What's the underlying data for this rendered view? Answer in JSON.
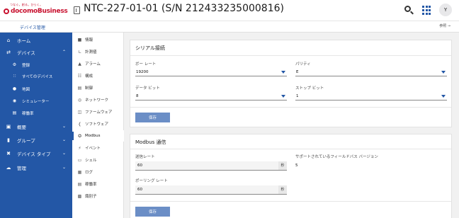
{
  "header": {
    "logo_tagline": "つなぐ。創る。ひらく。",
    "logo_brand_prefix": "docomo",
    "logo_brand_suffix": "Business",
    "page_title": "NTC-227-01-01 (S/N 212433235000816)",
    "avatar_initial": "Y"
  },
  "subheader": {
    "breadcrumb": "デバイス管理",
    "reference": "参照 →"
  },
  "sidebar": {
    "items": [
      {
        "label": "ホーム",
        "icon": "home-icon"
      },
      {
        "label": "デバイス",
        "icon": "swap-icon"
      },
      {
        "label": "登録",
        "icon": "register-icon"
      },
      {
        "label": "すべてのデバイス",
        "icon": "devices-icon"
      },
      {
        "label": "地図",
        "icon": "map-pin-icon"
      },
      {
        "label": "シミュレーター",
        "icon": "simulator-icon"
      },
      {
        "label": "稼働率",
        "icon": "chart-icon"
      },
      {
        "label": "概要",
        "icon": "overview-icon"
      },
      {
        "label": "グループ",
        "icon": "folder-icon"
      },
      {
        "label": "デバイス タイプ",
        "icon": "tools-icon"
      },
      {
        "label": "管理",
        "icon": "cloud-icon"
      }
    ]
  },
  "menu": {
    "items": [
      {
        "label": "情報"
      },
      {
        "label": "計測値"
      },
      {
        "label": "アラーム"
      },
      {
        "label": "構成"
      },
      {
        "label": "制御"
      },
      {
        "label": "ネットワーク"
      },
      {
        "label": "ファームウェア"
      },
      {
        "label": "ソフトウェア"
      },
      {
        "label": "Modbus"
      },
      {
        "label": "イベント"
      },
      {
        "label": "シェル"
      },
      {
        "label": "ログ"
      },
      {
        "label": "稼働率"
      },
      {
        "label": "識別子"
      }
    ]
  },
  "serial": {
    "title": "シリアル接続",
    "baud_label": "ボー レート",
    "baud_value": "19200",
    "parity_label": "パリティ",
    "parity_value": "E",
    "databits_label": "データ ビット",
    "databits_value": "8",
    "stopbits_label": "ストップ ビット",
    "stopbits_value": "1",
    "save_label": "保存"
  },
  "modbus": {
    "title": "Modbus 通信",
    "transmit_label": "送信レート",
    "transmit_value": "60",
    "transmit_unit": "秒",
    "fieldbus_label": "サポートされているフィールドバス バージョン",
    "fieldbus_value": "5",
    "polling_label": "ポーリング レート",
    "polling_value": "60",
    "polling_unit": "秒",
    "save_label": "保存"
  },
  "colors": {
    "brand_red": "#c8102e",
    "sidebar_blue": "#2357a6",
    "button_blue": "#6b8ec6"
  }
}
